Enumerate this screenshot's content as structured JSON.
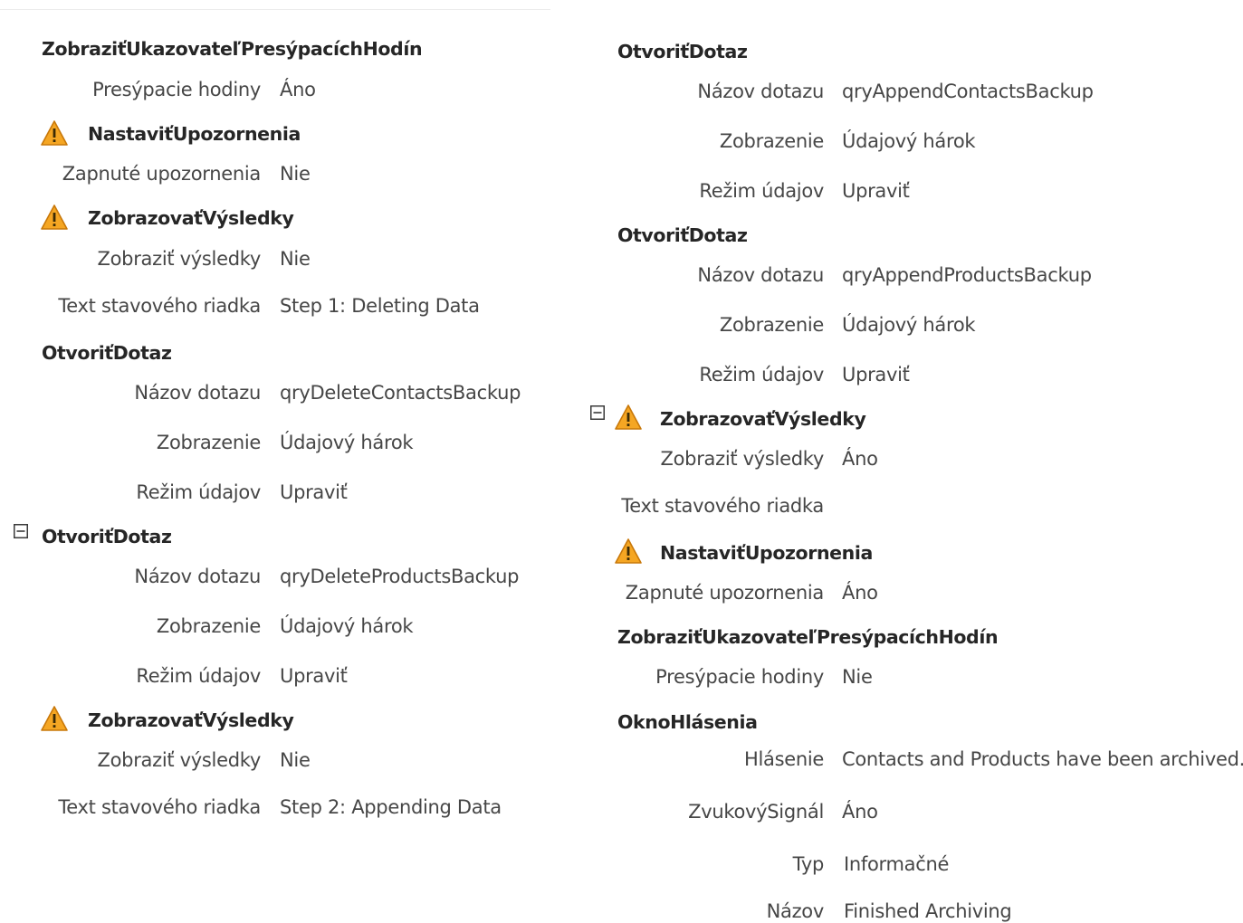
{
  "left": {
    "blocks": [
      {
        "action": "ZobraziťUkazovateľPresýpacíchHodín",
        "args": [
          {
            "label": "Presýpacie hodiny",
            "value": "Áno"
          }
        ]
      },
      {
        "action": "NastaviťUpozornenia",
        "icon": "warning-icon",
        "args": [
          {
            "label": "Zapnuté upozornenia",
            "value": "Nie"
          }
        ]
      },
      {
        "action": "ZobrazovaťVýsledky",
        "icon": "warning-icon",
        "args": [
          {
            "label": "Zobraziť výsledky",
            "value": "Nie"
          },
          {
            "label": "Text stavového riadka",
            "value": "Step 1: Deleting Data"
          }
        ]
      },
      {
        "action": "OtvoriťDotaz",
        "args": [
          {
            "label": "Názov dotazu",
            "value": "qryDeleteContactsBackup"
          },
          {
            "label": "Zobrazenie",
            "value": "Údajový hárok"
          },
          {
            "label": "Režim údajov",
            "value": "Upraviť"
          }
        ]
      },
      {
        "action": "OtvoriťDotaz",
        "collapsible": true,
        "args": [
          {
            "label": "Názov dotazu",
            "value": "qryDeleteProductsBackup"
          },
          {
            "label": "Zobrazenie",
            "value": "Údajový hárok"
          },
          {
            "label": "Režim údajov",
            "value": "Upraviť"
          }
        ]
      },
      {
        "action": "ZobrazovaťVýsledky",
        "icon": "warning-icon",
        "args": [
          {
            "label": "Zobraziť výsledky",
            "value": "Nie"
          },
          {
            "label": "Text stavového riadka",
            "value": "Step 2: Appending Data"
          }
        ]
      }
    ]
  },
  "right": {
    "blocks": [
      {
        "action": "OtvoriťDotaz",
        "args": [
          {
            "label": "Názov dotazu",
            "value": "qryAppendContactsBackup"
          },
          {
            "label": "Zobrazenie",
            "value": "Údajový hárok"
          },
          {
            "label": "Režim údajov",
            "value": "Upraviť"
          }
        ]
      },
      {
        "action": "OtvoriťDotaz",
        "args": [
          {
            "label": "Názov dotazu",
            "value": "qryAppendProductsBackup"
          },
          {
            "label": "Zobrazenie",
            "value": "Údajový hárok"
          },
          {
            "label": "Režim údajov",
            "value": "Upraviť"
          }
        ]
      },
      {
        "action": "ZobrazovaťVýsledky",
        "icon": "warning-icon",
        "collapsible": true,
        "args": [
          {
            "label": "Zobraziť výsledky",
            "value": "Áno"
          },
          {
            "label": "Text stavového riadka",
            "value": ""
          }
        ]
      },
      {
        "action": "NastaviťUpozornenia",
        "icon": "warning-icon",
        "args": [
          {
            "label": "Zapnuté upozornenia",
            "value": "Áno"
          }
        ]
      },
      {
        "action": "ZobraziťUkazovateľPresýpacíchHodín",
        "args": [
          {
            "label": "Presýpacie hodiny",
            "value": "Nie"
          }
        ]
      },
      {
        "action": "OknoHlásenia",
        "args": [
          {
            "label": "Hlásenie",
            "value": "Contacts and Products have been archived."
          },
          {
            "label": "ZvukovýSignál",
            "value": "Áno"
          },
          {
            "label": "Typ",
            "value": "Informačné"
          },
          {
            "label": "Názov",
            "value": "Finished Archiving"
          }
        ]
      }
    ]
  },
  "colors": {
    "warning_fill": "#f5a623",
    "warning_stroke": "#c8780a",
    "action_text": "#262626",
    "arg_text": "#464646"
  }
}
